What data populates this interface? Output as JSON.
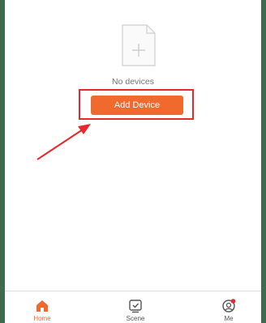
{
  "empty_state": {
    "icon": "empty-document-plus-icon",
    "message": "No devices",
    "add_button_label": "Add Device"
  },
  "annotation": {
    "box_color": "#e8282c",
    "arrow_color": "#e8282c"
  },
  "tabbar": {
    "tabs": [
      {
        "label": "Home",
        "icon": "home-icon",
        "active": true
      },
      {
        "label": "Scene",
        "icon": "scene-check-icon",
        "active": false
      },
      {
        "label": "Me",
        "icon": "profile-icon",
        "active": false,
        "badge": true
      }
    ]
  },
  "colors": {
    "accent": "#ef6a2c",
    "background_frame": "#3e6b4c",
    "badge": "#e8282c"
  }
}
